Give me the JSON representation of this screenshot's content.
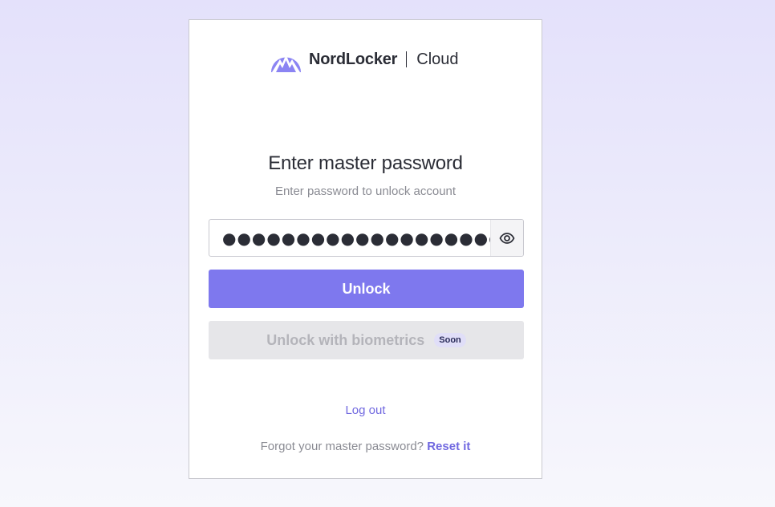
{
  "brand": {
    "name": "NordLocker",
    "product": "Cloud",
    "logo_icon": "nordlocker-mountain-logo",
    "accent_color": "#7e78ee"
  },
  "header": {
    "title": "Enter master password",
    "subtitle": "Enter password to unlock account"
  },
  "password_field": {
    "value": "●●●●●●●●●●●●●●●●●●●●",
    "toggle_icon": "eye-icon"
  },
  "buttons": {
    "unlock_label": "Unlock",
    "biometrics_label": "Unlock with biometrics",
    "biometrics_badge": "Soon"
  },
  "links": {
    "logout_label": "Log out",
    "forgot_text": "Forgot your master password?",
    "reset_label": "Reset it"
  }
}
